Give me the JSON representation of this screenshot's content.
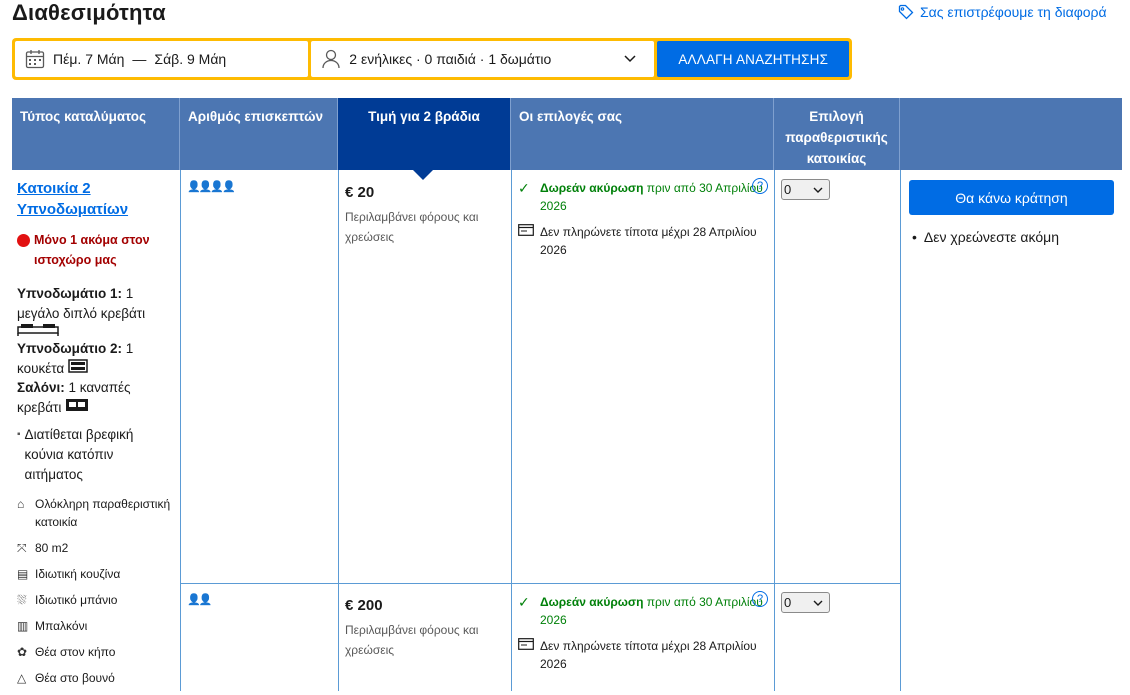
{
  "page": {
    "title": "Διαθεσιμότητα",
    "price_match": "Σας επιστρέφουμε τη διαφορά"
  },
  "search": {
    "checkin": "Πέμ. 7 Μάη",
    "separator": "—",
    "checkout": "Σάβ. 9 Μάη",
    "guests": "2 ενήλικες · 0 παιδιά · 1 δωμάτιο",
    "button": "ΑΛΛΑΓΗ ΑΝΑΖΗΤΗΣΗΣ"
  },
  "table": {
    "headers": {
      "type": "Τύπος καταλύματος",
      "guests": "Αριθμός επισκεπτών",
      "price": "Τιμή για 2 βράδια",
      "choices": "Οι επιλογές σας",
      "select": "Επιλογή παραθεριστικής κατοικίας"
    },
    "room": {
      "name": "Κατοικία 2 Υπνοδωματίων",
      "scarcity": "Μόνο 1 ακόμα στον ιστοχώρο μας",
      "bed1_label": "Υπνοδωμάτιο 1:",
      "bed1_value": "1 μεγάλο διπλό κρεβάτι",
      "bed2_label": "Υπνοδωμάτιο 2:",
      "bed2_value": "1 κουκέτα",
      "living_label": "Σαλόνι:",
      "living_value": "1 καναπές κρεβάτι",
      "crib": "Διατίθεται βρεφική κούνια κατόπιν αιτήματος",
      "facilities": [
        {
          "icon": "home-icon",
          "label": "Ολόκληρη παραθεριστική κατοικία"
        },
        {
          "icon": "size-icon",
          "label": "80 m2"
        },
        {
          "icon": "kitchen-icon",
          "label": "Ιδιωτική κουζίνα"
        },
        {
          "icon": "bath-icon",
          "label": "Ιδιωτικό μπάνιο"
        },
        {
          "icon": "balcony-icon",
          "label": "Μπαλκόνι"
        },
        {
          "icon": "garden-icon",
          "label": "Θέα στον κήπο"
        },
        {
          "icon": "mountain-icon",
          "label": "Θέα στο βουνό"
        }
      ]
    },
    "options": [
      {
        "people": 4,
        "price": "€ 20",
        "price_note": "Περιλαμβάνει φόρους και χρεώσεις",
        "free_cancel_bold": "Δωρεάν ακύρωση",
        "free_cancel_rest": "πριν από 30 Απριλίου 2026",
        "pay_later": "Δεν πληρώνετε τίποτα μέχρι 28 Απριλίου 2026",
        "qty": "0"
      },
      {
        "people": 2,
        "price": "€ 200",
        "price_note": "Περιλαμβάνει φόρους και χρεώσεις",
        "free_cancel_bold": "Δωρεάν ακύρωση",
        "free_cancel_rest": "πριν από 30 Απριλίου 2026",
        "pay_later": "Δεν πληρώνετε τίποτα μέχρι 28 Απριλίου 2026",
        "qty": "0"
      }
    ],
    "book_button": "Θα κάνω κράτηση",
    "no_charge": "Δεν χρεώνεστε ακόμη"
  },
  "colors": {
    "accent": "#006ce4",
    "header": "#4c76b2",
    "selected_header": "#003b95",
    "search_border": "#febb02",
    "free": "#008009",
    "scarcity": "#a30000"
  }
}
